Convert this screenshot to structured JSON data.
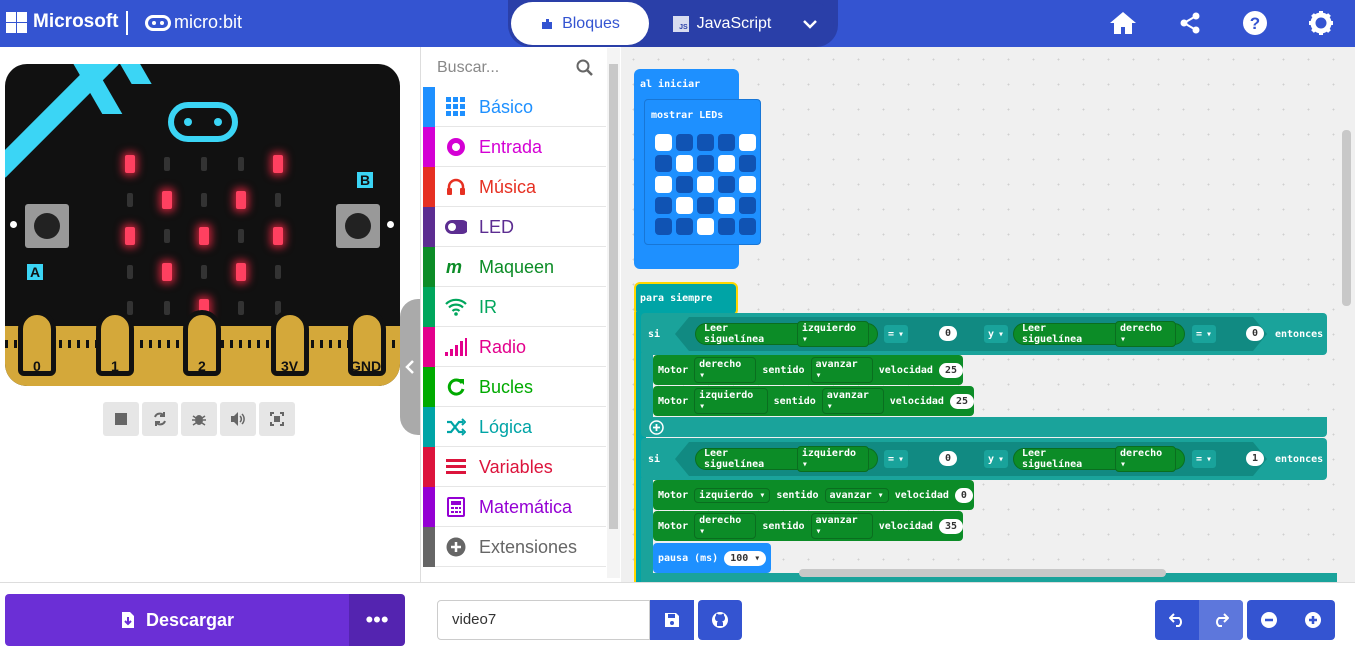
{
  "topbar": {
    "brand": "Microsoft",
    "product": "micro:bit",
    "tab_blocks": "Bloques",
    "tab_js": "JavaScript",
    "js_badge": "JS",
    "icons": [
      "home-icon",
      "share-icon",
      "help-icon",
      "settings-icon"
    ],
    "color": "#3454d1"
  },
  "simulator": {
    "btn_a": "A",
    "btn_b": "B",
    "pins": [
      "0",
      "1",
      "2",
      "3V",
      "GND"
    ],
    "controls": [
      "stop-icon",
      "restart-icon",
      "debug-icon",
      "sound-icon",
      "fullscreen-icon"
    ],
    "led_matrix": [
      [
        1,
        0,
        0,
        0,
        1
      ],
      [
        0,
        1,
        0,
        1,
        0
      ],
      [
        1,
        0,
        1,
        0,
        1
      ],
      [
        0,
        1,
        0,
        1,
        0
      ],
      [
        0,
        0,
        1,
        0,
        0
      ]
    ]
  },
  "toolbox": {
    "search_placeholder": "Buscar...",
    "categories": [
      {
        "label": "Básico",
        "color": "#1e90ff",
        "icon": "grid-icon"
      },
      {
        "label": "Entrada",
        "color": "#d400d4",
        "icon": "input-icon"
      },
      {
        "label": "Música",
        "color": "#e63022",
        "icon": "headphones-icon"
      },
      {
        "label": "LED",
        "color": "#5c2d91",
        "icon": "toggle-icon"
      },
      {
        "label": "Maqueen",
        "color": "#0c8c27",
        "icon": "maqueen-icon"
      },
      {
        "label": "IR",
        "color": "#00a65c",
        "icon": "wifi-icon"
      },
      {
        "label": "Radio",
        "color": "#e3008c",
        "icon": "signal-icon"
      },
      {
        "label": "Bucles",
        "color": "#00aa00",
        "icon": "loop-icon"
      },
      {
        "label": "Lógica",
        "color": "#00a4a6",
        "icon": "shuffle-icon"
      },
      {
        "label": "Variables",
        "color": "#dc143c",
        "icon": "list-icon"
      },
      {
        "label": "Matemática",
        "color": "#9400d3",
        "icon": "calculator-icon"
      },
      {
        "label": "Extensiones",
        "color": "#666666",
        "icon": "plus-circle-icon"
      }
    ]
  },
  "workspace": {
    "on_start": "al iniciar",
    "show_leds": "mostrar LEDs",
    "show_leds_matrix": [
      [
        1,
        1,
        1,
        1,
        1
      ],
      [
        1,
        1,
        1,
        1,
        1
      ],
      [
        1,
        1,
        1,
        1,
        1
      ],
      [
        1,
        1,
        1,
        1,
        1
      ],
      [
        1,
        1,
        1,
        1,
        1
      ]
    ],
    "show_leds_white": [
      [
        1,
        0,
        0,
        0,
        1
      ],
      [
        0,
        1,
        0,
        1,
        0
      ],
      [
        1,
        0,
        1,
        0,
        1
      ],
      [
        0,
        1,
        0,
        1,
        0
      ],
      [
        0,
        0,
        1,
        0,
        0
      ]
    ],
    "forever": "para siempre",
    "if_kw": "si",
    "then_kw": "entonces",
    "and_kw": "y",
    "read_line": "Leer siguelínea",
    "left": "izquierdo",
    "right": "derecho",
    "eq": "=",
    "motor": "Motor",
    "sentido": "sentido",
    "forward": "avanzar",
    "velocity": "velocidad",
    "pause": "pausa (ms)",
    "pause_val": "100",
    "if1": {
      "lval": "0",
      "rval": "0"
    },
    "if1_motors": [
      {
        "side": "derecho",
        "speed": "25"
      },
      {
        "side": "izquierdo",
        "speed": "25"
      }
    ],
    "if2": {
      "lval": "0",
      "rval": "1"
    },
    "if2_motors": [
      {
        "side": "izquierdo",
        "speed": "0"
      },
      {
        "side": "derecho",
        "speed": "35"
      }
    ]
  },
  "bottombar": {
    "download": "Descargar",
    "more": "•••",
    "project_name": "video7"
  }
}
